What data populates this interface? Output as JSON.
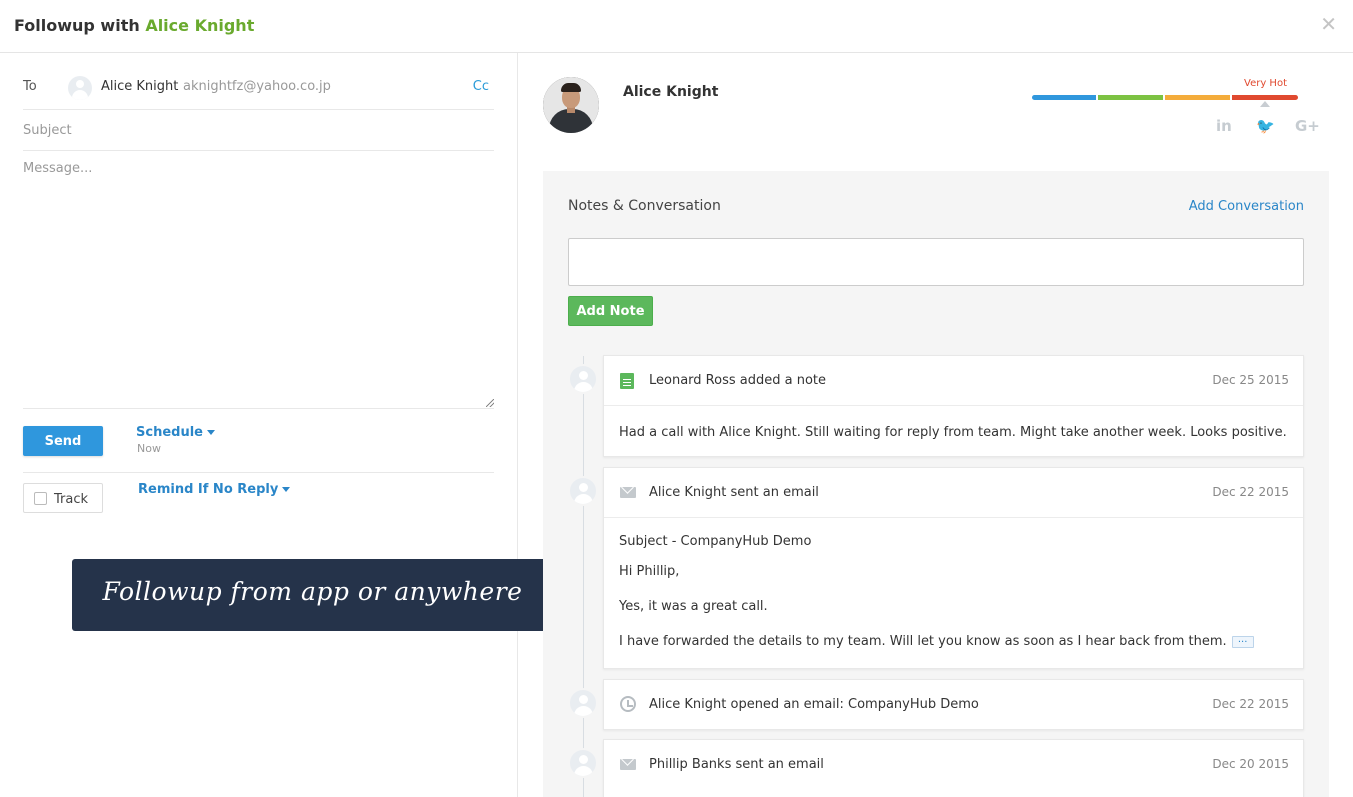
{
  "header": {
    "title_prefix": "Followup with",
    "contact_name": "Alice Knight",
    "close_glyph": "✕"
  },
  "compose": {
    "to_label": "To",
    "recipient_name": "Alice Knight",
    "recipient_email": "aknightfz@yahoo.co.jp",
    "cc_label": "Cc",
    "subject_placeholder": "Subject",
    "message_placeholder": "Message...",
    "send_label": "Send",
    "schedule_label": "Schedule",
    "schedule_sub": "Now",
    "track_label": "Track",
    "remind_label": "Remind If No Reply"
  },
  "banner": {
    "text": "Followup from app or anywhere"
  },
  "profile": {
    "name": "Alice Knight",
    "temperature_label": "Very Hot",
    "temperature_level": 4,
    "temperature_scale": 4,
    "heat_colors": [
      "#2f97dd",
      "#7cc242",
      "#f4ac3b",
      "#e0492f"
    ],
    "social": [
      {
        "icon": "linkedin-icon",
        "glyph": "in"
      },
      {
        "icon": "twitter-icon",
        "glyph": "🐦"
      },
      {
        "icon": "google-plus-icon",
        "glyph": "G+"
      }
    ]
  },
  "notes": {
    "title": "Notes & Conversation",
    "add_conversation_label": "Add Conversation",
    "add_note_label": "Add Note",
    "timeline": [
      {
        "icon": "note-icon",
        "title": "Leonard Ross added a note",
        "date": "Dec 25 2015",
        "body": [
          "Had a call with Alice Knight. Still waiting for reply from team. Might take another week. Looks positive."
        ]
      },
      {
        "icon": "email-icon",
        "title": "Alice Knight sent an email",
        "date": "Dec 22 2015",
        "body": [
          "Subject - CompanyHub Demo",
          "Hi Phillip,",
          "Yes, it was a great call.",
          "I have forwarded the details to my team. Will let you know as soon as I hear back from them."
        ],
        "more_label": "..."
      },
      {
        "icon": "history-icon",
        "title": "Alice Knight opened an email: CompanyHub Demo",
        "date": "Dec 22 2015"
      },
      {
        "icon": "email-icon",
        "title": "Phillip Banks sent an email",
        "date": "Dec 20 2015"
      }
    ]
  }
}
